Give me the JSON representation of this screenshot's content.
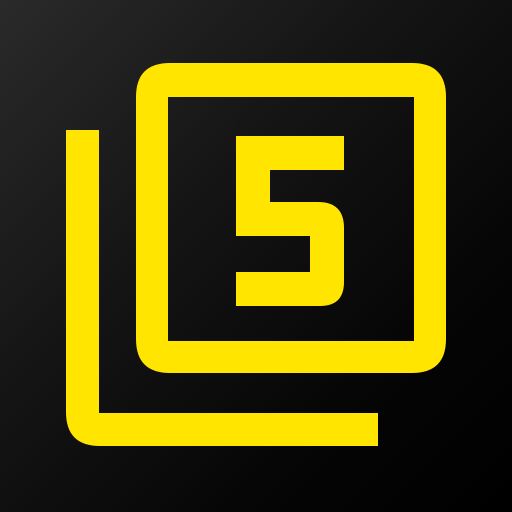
{
  "icon": {
    "name": "filter-5-icon",
    "number": "5",
    "colors": {
      "foreground": "#FFE500",
      "background_top_left": "#2a2a2a",
      "background_bottom_right": "#000000"
    }
  }
}
